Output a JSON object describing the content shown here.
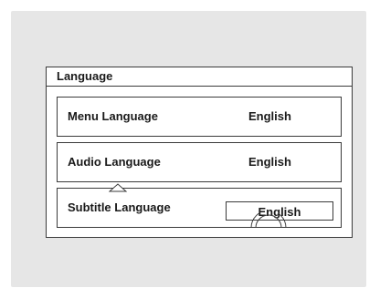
{
  "panel": {
    "title": "Language"
  },
  "rows": [
    {
      "label": "Menu Language",
      "value": "English"
    },
    {
      "label": "Audio Language",
      "value": "English"
    },
    {
      "label": "Subtitle Language",
      "value": "English"
    }
  ],
  "icons": {
    "scroll_up": "triangle-up-icon",
    "dial": "dial-knob-icon"
  }
}
